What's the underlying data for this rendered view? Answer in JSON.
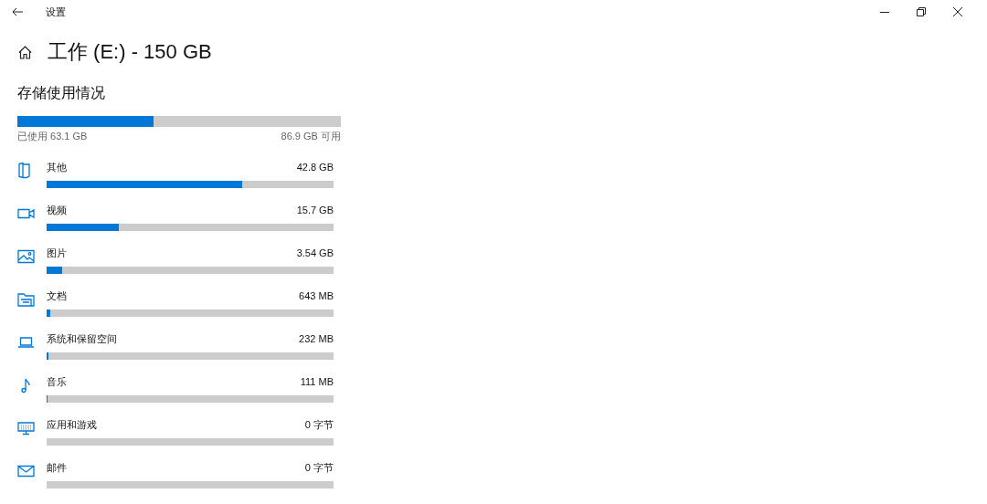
{
  "window": {
    "title": "设置"
  },
  "page_title": "工作 (E:) - 150 GB",
  "section_title": "存储使用情况",
  "total": {
    "level": 0.42,
    "used": "已使用 63.1 GB",
    "free": "86.9 GB 可用"
  },
  "categories": [
    {
      "kind": "other",
      "name": "其他",
      "size": "42.8 GB",
      "level": 0.68
    },
    {
      "kind": "video",
      "name": "视频",
      "size": "15.7 GB",
      "level": 0.25
    },
    {
      "kind": "pictures",
      "name": "图片",
      "size": "3.54 GB",
      "level": 0.054
    },
    {
      "kind": "documents",
      "name": "文档",
      "size": "643 MB",
      "level": 0.012
    },
    {
      "kind": "system",
      "name": "系统和保留空间",
      "size": "232 MB",
      "level": 0.005
    },
    {
      "kind": "music",
      "name": "音乐",
      "size": "111 MB",
      "level": 0.004
    },
    {
      "kind": "apps",
      "name": "应用和游戏",
      "size": "0 字节"
    },
    {
      "kind": "mail",
      "name": "邮件",
      "size": "0 字节"
    }
  ]
}
